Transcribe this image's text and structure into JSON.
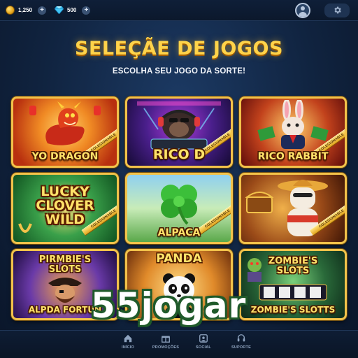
{
  "topbar": {
    "coins": "1,250",
    "gems": "500",
    "coin_icon": "gold-coin-icon",
    "gem_icon": "blue-diamond-icon"
  },
  "header": {
    "title": "SELEÇÃE DE JOGOS",
    "subtitle": "ESCOLHA SEU JOGO DA SORTE!"
  },
  "games": [
    {
      "name": "YO DRAGON",
      "badge": "COLECIONABLE"
    },
    {
      "name": "RICO D",
      "badge": "COLECIONABLE"
    },
    {
      "name": "RICO RABBIT",
      "badge": "COLECIONABLE"
    },
    {
      "name": "LUCKY CLOVER WILD",
      "line1": "LUCKY",
      "line2": "CLOVER",
      "line3": "WILD",
      "badge": "COLECIONABLE"
    },
    {
      "name": "ALPACA",
      "badge": "COLECIONABLE"
    },
    {
      "name": "",
      "badge": "COLECIONABLE"
    },
    {
      "top": "PIRMBIE'S SLOTS",
      "top1": "PIRMBIE'S",
      "top2": "SLOTS",
      "name": "ALPDA FORTUN"
    },
    {
      "top": "PANDA",
      "name": ""
    },
    {
      "top": "ZOMBIE'S SLOTS",
      "top1": "ZOMBIE'S",
      "top2": "SLOTS",
      "name": "ZOMBIE'S SLOTTS"
    }
  ],
  "watermark": "55jogar",
  "nav": [
    {
      "label": "INÍCIO",
      "icon": "home-icon"
    },
    {
      "label": "PROMOÇÕES",
      "icon": "gift-icon"
    },
    {
      "label": "SOCIAL",
      "icon": "social-icon"
    },
    {
      "label": "SUPORTE",
      "icon": "support-icon"
    }
  ],
  "colors": {
    "background": "#10233f",
    "title_gold": "#ffd34a",
    "card_border": "#f2c24a"
  }
}
